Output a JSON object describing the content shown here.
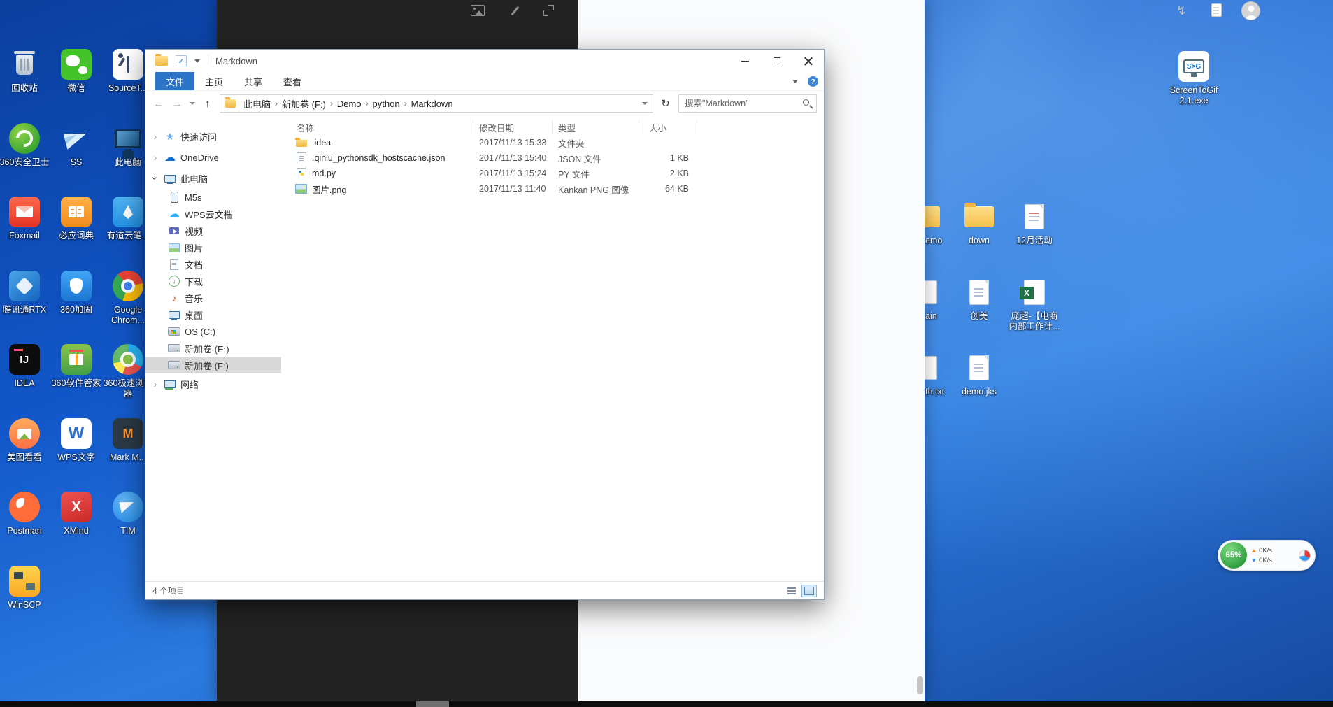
{
  "colors": {
    "accent_blue": "#2b74c8",
    "sidebar_selection": "#d9d9d9",
    "traffic_green": "#3cb043",
    "desktop_blue": "#1156c8"
  },
  "desktop": {
    "left_icons": [
      {
        "name": "recycle-bin",
        "label": "回收站"
      },
      {
        "name": "wechat",
        "label": "微信"
      },
      {
        "name": "sourcetree",
        "label": "SourceT..."
      },
      {
        "name": "360-safe",
        "label": "360安全卫士"
      },
      {
        "name": "ss",
        "label": "SS"
      },
      {
        "name": "this-pc",
        "label": "此电脑"
      },
      {
        "name": "foxmail",
        "label": "Foxmail"
      },
      {
        "name": "bing-dict",
        "label": "必应词典"
      },
      {
        "name": "youdao-note",
        "label": "有道云笔..."
      },
      {
        "name": "tencent-rtx",
        "label": "腾讯通RTX"
      },
      {
        "name": "360-jiagu",
        "label": "360加固"
      },
      {
        "name": "chrome",
        "label": "Google Chrom..."
      },
      {
        "name": "idea",
        "label": "IDEA",
        "glyph": "IJ"
      },
      {
        "name": "360-manager",
        "label": "360软件管家"
      },
      {
        "name": "360-browser",
        "label": "360极速浏览器"
      },
      {
        "name": "meitu-kankan",
        "label": "美图看看"
      },
      {
        "name": "wps-writer",
        "label": "WPS文字",
        "glyph": "W"
      },
      {
        "name": "markman",
        "label": "Mark M...",
        "glyph": "M"
      },
      {
        "name": "postman",
        "label": "Postman"
      },
      {
        "name": "xmind",
        "label": "XMind",
        "glyph": "X"
      },
      {
        "name": "tim",
        "label": "TIM"
      },
      {
        "name": "winscp",
        "label": "WinSCP"
      }
    ],
    "right_icons": [
      {
        "name": "demo-folder-clipped",
        "label": "emo",
        "kind": "folder-half"
      },
      {
        "name": "down-folder",
        "label": "down",
        "kind": "folder"
      },
      {
        "name": "december-activity",
        "label": "12月活动",
        "kind": "doc"
      },
      {
        "name": "main-clipped",
        "label": "ain",
        "kind": "doc-half"
      },
      {
        "name": "chuangmei",
        "label": "创美",
        "kind": "doc"
      },
      {
        "name": "pangchao-excel",
        "label": "庞超-【电商内部工作计...",
        "kind": "excel"
      },
      {
        "name": "txt-clipped",
        "label": "th.txt",
        "kind": "doc-half"
      },
      {
        "name": "demo-jks",
        "label": "demo.jks",
        "kind": "doc"
      }
    ],
    "screentogif": {
      "label_line1": "ScreenToGif",
      "label_line2": "2.1.exe",
      "glyph": "S>G"
    },
    "traffic_ball": {
      "percent": "65%",
      "upload": "0K/s",
      "download": "0K/s"
    }
  },
  "editor": {
    "toolbar_dark_icons": [
      "image-icon",
      "pen-icon",
      "fullscreen-icon"
    ],
    "toolbar_light_icons": [
      "flash-icon",
      "document-icon",
      "user-avatar"
    ]
  },
  "explorer": {
    "title": "Markdown",
    "tabs": [
      {
        "label": "文件",
        "active": true
      },
      {
        "label": "主页",
        "active": false
      },
      {
        "label": "共享",
        "active": false
      },
      {
        "label": "查看",
        "active": false
      }
    ],
    "address": {
      "breadcrumb": [
        "此电脑",
        "新加卷 (F:)",
        "Demo",
        "python",
        "Markdown"
      ],
      "search_placeholder": "搜索\"Markdown\""
    },
    "sidebar": {
      "items": [
        {
          "label": "快速访问",
          "icon": "star",
          "chevron": "collapsed"
        },
        {
          "label": "OneDrive",
          "icon": "cloud",
          "chevron": "collapsed"
        },
        {
          "label": "此电脑",
          "icon": "computer",
          "chevron": "expanded"
        },
        {
          "label": "M5s",
          "icon": "phone",
          "child": true
        },
        {
          "label": "WPS云文档",
          "icon": "cloud",
          "child": true
        },
        {
          "label": "视频",
          "icon": "video",
          "child": true
        },
        {
          "label": "图片",
          "icon": "picture",
          "child": true
        },
        {
          "label": "文档",
          "icon": "document",
          "child": true
        },
        {
          "label": "下载",
          "icon": "download",
          "child": true
        },
        {
          "label": "音乐",
          "icon": "music",
          "child": true
        },
        {
          "label": "桌面",
          "icon": "desktop",
          "child": true
        },
        {
          "label": "OS (C:)",
          "icon": "drive-os",
          "child": true
        },
        {
          "label": "新加卷 (E:)",
          "icon": "drive",
          "child": true
        },
        {
          "label": "新加卷 (F:)",
          "icon": "drive",
          "child": true,
          "selected": true
        },
        {
          "label": "网络",
          "icon": "network",
          "chevron": "collapsed"
        }
      ]
    },
    "columns": [
      "名称",
      "修改日期",
      "类型",
      "大小"
    ],
    "files": [
      {
        "icon": "folder",
        "name": ".idea",
        "date": "2017/11/13 15:33",
        "type": "文件夹",
        "size": ""
      },
      {
        "icon": "json",
        "name": ".qiniu_pythonsdk_hostscache.json",
        "date": "2017/11/13 15:40",
        "type": "JSON 文件",
        "size": "1 KB"
      },
      {
        "icon": "python",
        "name": "md.py",
        "date": "2017/11/13 15:24",
        "type": "PY 文件",
        "size": "2 KB"
      },
      {
        "icon": "image",
        "name": "图片.png",
        "date": "2017/11/13 11:40",
        "type": "Kankan PNG 图像",
        "size": "64 KB"
      }
    ],
    "status_text": "4 个项目"
  }
}
